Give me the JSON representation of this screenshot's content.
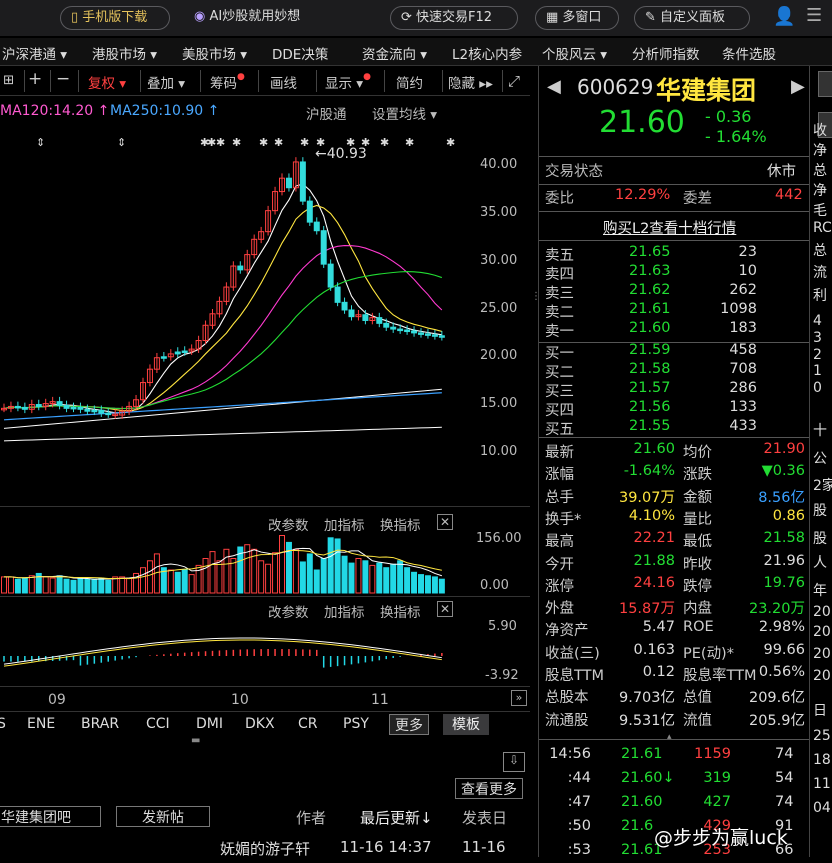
{
  "topbar": {
    "mobile": "手机版下载",
    "ai": "AI炒股就用妙想",
    "quick": "快速交易F12",
    "multi": "多窗口",
    "custom": "自定义面板"
  },
  "menu": [
    "沪深港通",
    "港股市场",
    "美股市场",
    "DDE决策",
    "资金流向",
    "L2核心内参",
    "个股风云",
    "分析师指数",
    "条件选股"
  ],
  "toolbar": {
    "fuquan": "复权",
    "diejia": "叠加",
    "chouma": "筹码",
    "huaxian": "画线",
    "xianshi": "显示",
    "jianyue": "简约",
    "yincang": "隐藏"
  },
  "ma": {
    "ma120": "MA120:14.20",
    "ma250": "MA250:10.90",
    "hgt": "沪股通",
    "setting": "设置均线"
  },
  "price_axis": [
    "40.00",
    "35.00",
    "30.00",
    "25.00",
    "20.00",
    "15.00",
    "10.00"
  ],
  "peak": "40.93",
  "vol": {
    "change": "改参数",
    "add": "加指标",
    "swap": "换指标",
    "max": "156.00",
    "min": "0.00"
  },
  "macd": {
    "change": "改参数",
    "add": "加指标",
    "swap": "换指标",
    "max": "5.90",
    "min": "-3.92"
  },
  "months": [
    "09",
    "10",
    "11"
  ],
  "indicators": [
    "S",
    "ENE",
    "BRAR",
    "CCI",
    "DMI",
    "DKX",
    "CR",
    "PSY",
    "更多",
    "模板"
  ],
  "forum": {
    "more": "查看更多",
    "bar": "华建集团吧",
    "post": "发新帖",
    "author": "作者",
    "last": "最后更新",
    "pub": "发表日",
    "user": "妩媚的游子轩",
    "last_time": "11-16 14:37",
    "pub_date": "11-16"
  },
  "stock": {
    "code": "600629",
    "name": "华建集团",
    "price": "21.60",
    "change": "- 0.36",
    "pct": "- 1.64%",
    "status_lbl": "交易状态",
    "status": "休市",
    "weibi_lbl": "委比",
    "weibi": "12.29%",
    "weicha_lbl": "委差",
    "weicha": "442",
    "l2": "购买L2查看十档行情"
  },
  "asks": [
    {
      "l": "卖五",
      "p": "21.65",
      "v": "23"
    },
    {
      "l": "卖四",
      "p": "21.63",
      "v": "10"
    },
    {
      "l": "卖三",
      "p": "21.62",
      "v": "262"
    },
    {
      "l": "卖二",
      "p": "21.61",
      "v": "1098"
    },
    {
      "l": "卖一",
      "p": "21.60",
      "v": "183"
    }
  ],
  "bids": [
    {
      "l": "买一",
      "p": "21.59",
      "v": "458"
    },
    {
      "l": "买二",
      "p": "21.58",
      "v": "708"
    },
    {
      "l": "买三",
      "p": "21.57",
      "v": "286"
    },
    {
      "l": "买四",
      "p": "21.56",
      "v": "133"
    },
    {
      "l": "买五",
      "p": "21.55",
      "v": "433"
    }
  ],
  "stats": [
    {
      "a": "最新",
      "av": "21.60",
      "ac": "g",
      "b": "均价",
      "bv": "21.90",
      "bc": "r"
    },
    {
      "a": "涨幅",
      "av": "-1.64%",
      "ac": "g",
      "b": "涨跌",
      "bv": "▼0.36",
      "bc": "g"
    },
    {
      "a": "总手",
      "av": "39.07万",
      "ac": "y",
      "b": "金额",
      "bv": "8.56亿",
      "bc": "b"
    },
    {
      "a": "换手*",
      "av": "4.10%",
      "ac": "y",
      "b": "量比",
      "bv": "0.86",
      "bc": "y"
    },
    {
      "a": "最高",
      "av": "22.21",
      "ac": "r",
      "b": "最低",
      "bv": "21.58",
      "bc": "g"
    },
    {
      "a": "今开",
      "av": "21.88",
      "ac": "g",
      "b": "昨收",
      "bv": "21.96",
      "bc": "wt"
    },
    {
      "a": "涨停",
      "av": "24.16",
      "ac": "r",
      "b": "跌停",
      "bv": "19.76",
      "bc": "g"
    },
    {
      "a": "外盘",
      "av": "15.87万",
      "ac": "r",
      "b": "内盘",
      "bv": "23.20万",
      "bc": "g"
    },
    {
      "a": "净资产",
      "av": "5.47",
      "ac": "wt",
      "b": "ROE",
      "bv": "2.98%",
      "bc": "wt"
    },
    {
      "a": "收益(三)",
      "av": "0.163",
      "ac": "wt",
      "b": "PE(动)*",
      "bv": "99.66",
      "bc": "wt"
    },
    {
      "a": "股息TTM",
      "av": "0.12",
      "ac": "wt",
      "b": "股息率TTM",
      "bv": "0.56%",
      "bc": "wt"
    },
    {
      "a": "总股本",
      "av": "9.703亿",
      "ac": "wt",
      "b": "总值",
      "bv": "209.6亿",
      "bc": "wt"
    },
    {
      "a": "流通股",
      "av": "9.531亿",
      "ac": "wt",
      "b": "流值",
      "bv": "205.9亿",
      "bc": "wt"
    }
  ],
  "ticks": [
    {
      "t": "14:56",
      "p": "21.61",
      "pc": "g",
      "v": "1159",
      "vc": "r",
      "n": "74"
    },
    {
      "t": ":44",
      "p": "21.60↓",
      "pc": "g",
      "v": "319",
      "vc": "g",
      "n": "54"
    },
    {
      "t": ":47",
      "p": "21.60",
      "pc": "g",
      "v": "427",
      "vc": "g",
      "n": "74"
    },
    {
      "t": ":50",
      "p": "21.6",
      "pc": "g",
      "v": "429",
      "vc": "r",
      "n": "91"
    },
    {
      "t": ":53",
      "p": "21.61",
      "pc": "g",
      "v": "253",
      "vc": "r",
      "n": "66"
    }
  ],
  "far_right": [
    "收",
    "净",
    "总",
    "净",
    "毛",
    "RC",
    "总",
    "流",
    "利",
    "4",
    "3",
    "2",
    "1",
    "0",
    "十",
    "公",
    "2家",
    "股",
    "股",
    "人",
    "年",
    "20",
    "20",
    "20",
    "20",
    "日",
    "25",
    "18",
    "11",
    "04"
  ],
  "watermark": "@步步为赢luck"
}
